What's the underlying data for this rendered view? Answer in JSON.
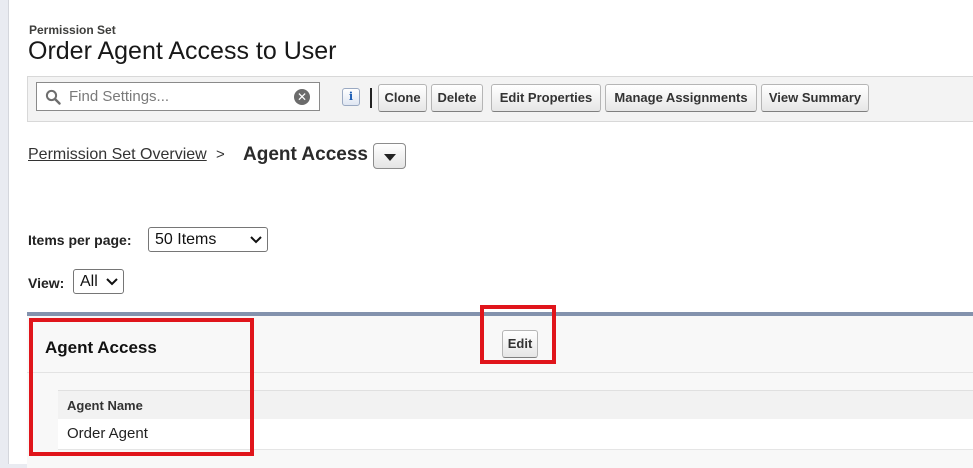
{
  "header": {
    "kicker": "Permission Set",
    "title": "Order Agent Access to User"
  },
  "toolbar": {
    "search_placeholder": "Find Settings...",
    "clear_glyph": "✕",
    "info_glyph": "i",
    "buttons": [
      "Clone",
      "Delete",
      "Edit Properties",
      "Manage Assignments",
      "View Summary"
    ]
  },
  "breadcrumb": {
    "parent": "Permission Set Overview",
    "separator": ">",
    "current": "Agent Access"
  },
  "paging": {
    "items_per_page_label": "Items per page:",
    "items_per_page_value": "50 Items",
    "view_label": "View:",
    "view_value": "All"
  },
  "section": {
    "title": "Agent Access",
    "edit_label": "Edit",
    "table": {
      "columns": [
        "Agent Name"
      ],
      "rows": [
        [
          "Order Agent"
        ]
      ]
    }
  },
  "colors": {
    "highlight": "#e0151b",
    "section_border": "#8392ad"
  }
}
